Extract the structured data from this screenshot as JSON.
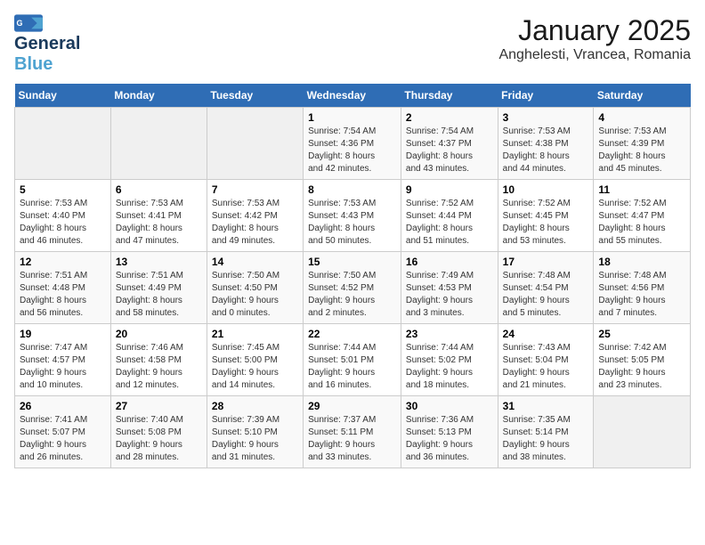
{
  "header": {
    "logo_line1": "General",
    "logo_line2": "Blue",
    "title": "January 2025",
    "subtitle": "Anghelesti, Vrancea, Romania"
  },
  "weekdays": [
    "Sunday",
    "Monday",
    "Tuesday",
    "Wednesday",
    "Thursday",
    "Friday",
    "Saturday"
  ],
  "weeks": [
    [
      {
        "day": "",
        "info": ""
      },
      {
        "day": "",
        "info": ""
      },
      {
        "day": "",
        "info": ""
      },
      {
        "day": "1",
        "info": "Sunrise: 7:54 AM\nSunset: 4:36 PM\nDaylight: 8 hours\nand 42 minutes."
      },
      {
        "day": "2",
        "info": "Sunrise: 7:54 AM\nSunset: 4:37 PM\nDaylight: 8 hours\nand 43 minutes."
      },
      {
        "day": "3",
        "info": "Sunrise: 7:53 AM\nSunset: 4:38 PM\nDaylight: 8 hours\nand 44 minutes."
      },
      {
        "day": "4",
        "info": "Sunrise: 7:53 AM\nSunset: 4:39 PM\nDaylight: 8 hours\nand 45 minutes."
      }
    ],
    [
      {
        "day": "5",
        "info": "Sunrise: 7:53 AM\nSunset: 4:40 PM\nDaylight: 8 hours\nand 46 minutes."
      },
      {
        "day": "6",
        "info": "Sunrise: 7:53 AM\nSunset: 4:41 PM\nDaylight: 8 hours\nand 47 minutes."
      },
      {
        "day": "7",
        "info": "Sunrise: 7:53 AM\nSunset: 4:42 PM\nDaylight: 8 hours\nand 49 minutes."
      },
      {
        "day": "8",
        "info": "Sunrise: 7:53 AM\nSunset: 4:43 PM\nDaylight: 8 hours\nand 50 minutes."
      },
      {
        "day": "9",
        "info": "Sunrise: 7:52 AM\nSunset: 4:44 PM\nDaylight: 8 hours\nand 51 minutes."
      },
      {
        "day": "10",
        "info": "Sunrise: 7:52 AM\nSunset: 4:45 PM\nDaylight: 8 hours\nand 53 minutes."
      },
      {
        "day": "11",
        "info": "Sunrise: 7:52 AM\nSunset: 4:47 PM\nDaylight: 8 hours\nand 55 minutes."
      }
    ],
    [
      {
        "day": "12",
        "info": "Sunrise: 7:51 AM\nSunset: 4:48 PM\nDaylight: 8 hours\nand 56 minutes."
      },
      {
        "day": "13",
        "info": "Sunrise: 7:51 AM\nSunset: 4:49 PM\nDaylight: 8 hours\nand 58 minutes."
      },
      {
        "day": "14",
        "info": "Sunrise: 7:50 AM\nSunset: 4:50 PM\nDaylight: 9 hours\nand 0 minutes."
      },
      {
        "day": "15",
        "info": "Sunrise: 7:50 AM\nSunset: 4:52 PM\nDaylight: 9 hours\nand 2 minutes."
      },
      {
        "day": "16",
        "info": "Sunrise: 7:49 AM\nSunset: 4:53 PM\nDaylight: 9 hours\nand 3 minutes."
      },
      {
        "day": "17",
        "info": "Sunrise: 7:48 AM\nSunset: 4:54 PM\nDaylight: 9 hours\nand 5 minutes."
      },
      {
        "day": "18",
        "info": "Sunrise: 7:48 AM\nSunset: 4:56 PM\nDaylight: 9 hours\nand 7 minutes."
      }
    ],
    [
      {
        "day": "19",
        "info": "Sunrise: 7:47 AM\nSunset: 4:57 PM\nDaylight: 9 hours\nand 10 minutes."
      },
      {
        "day": "20",
        "info": "Sunrise: 7:46 AM\nSunset: 4:58 PM\nDaylight: 9 hours\nand 12 minutes."
      },
      {
        "day": "21",
        "info": "Sunrise: 7:45 AM\nSunset: 5:00 PM\nDaylight: 9 hours\nand 14 minutes."
      },
      {
        "day": "22",
        "info": "Sunrise: 7:44 AM\nSunset: 5:01 PM\nDaylight: 9 hours\nand 16 minutes."
      },
      {
        "day": "23",
        "info": "Sunrise: 7:44 AM\nSunset: 5:02 PM\nDaylight: 9 hours\nand 18 minutes."
      },
      {
        "day": "24",
        "info": "Sunrise: 7:43 AM\nSunset: 5:04 PM\nDaylight: 9 hours\nand 21 minutes."
      },
      {
        "day": "25",
        "info": "Sunrise: 7:42 AM\nSunset: 5:05 PM\nDaylight: 9 hours\nand 23 minutes."
      }
    ],
    [
      {
        "day": "26",
        "info": "Sunrise: 7:41 AM\nSunset: 5:07 PM\nDaylight: 9 hours\nand 26 minutes."
      },
      {
        "day": "27",
        "info": "Sunrise: 7:40 AM\nSunset: 5:08 PM\nDaylight: 9 hours\nand 28 minutes."
      },
      {
        "day": "28",
        "info": "Sunrise: 7:39 AM\nSunset: 5:10 PM\nDaylight: 9 hours\nand 31 minutes."
      },
      {
        "day": "29",
        "info": "Sunrise: 7:37 AM\nSunset: 5:11 PM\nDaylight: 9 hours\nand 33 minutes."
      },
      {
        "day": "30",
        "info": "Sunrise: 7:36 AM\nSunset: 5:13 PM\nDaylight: 9 hours\nand 36 minutes."
      },
      {
        "day": "31",
        "info": "Sunrise: 7:35 AM\nSunset: 5:14 PM\nDaylight: 9 hours\nand 38 minutes."
      },
      {
        "day": "",
        "info": ""
      }
    ]
  ]
}
